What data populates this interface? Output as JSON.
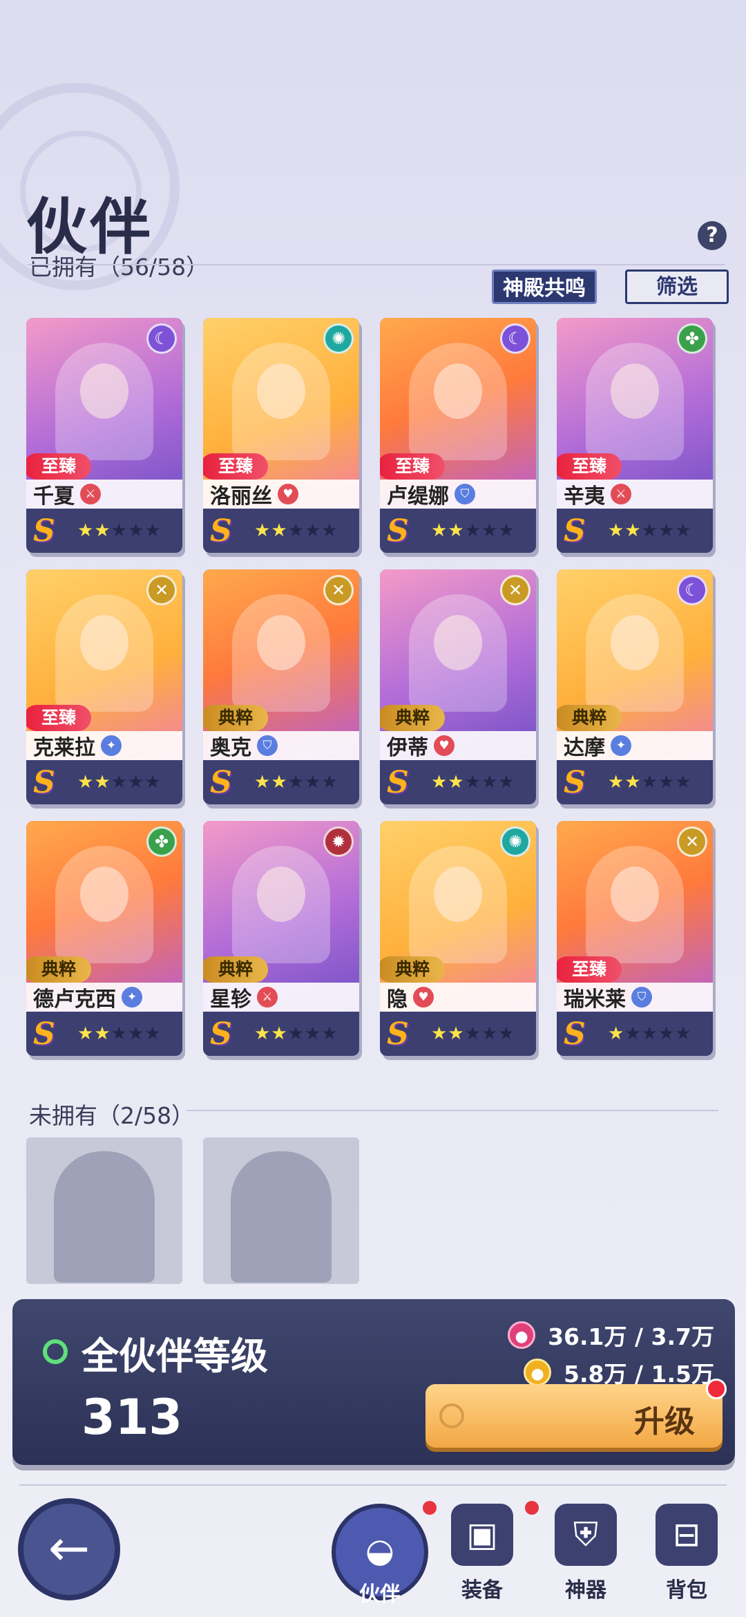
{
  "header": {
    "title": "伙伴",
    "owned_label": "已拥有（56/58）",
    "help_label": "?",
    "resonance_button": "神殿共鸣",
    "filter_button": "筛选"
  },
  "owned_heroes": [
    {
      "name": "千夏",
      "rarity": "至臻",
      "rarity_color": "#e8203c",
      "element_icon": "moon-icon",
      "class_icon": "sword-icon",
      "grade": "S",
      "stars": 2,
      "max_stars": 5
    },
    {
      "name": "洛丽丝",
      "rarity": "至臻",
      "rarity_color": "#e8203c",
      "element_icon": "wind-icon",
      "class_icon": "heart-icon",
      "grade": "S",
      "stars": 2,
      "max_stars": 5
    },
    {
      "name": "卢缇娜",
      "rarity": "至臻",
      "rarity_color": "#e8203c",
      "element_icon": "moon-icon",
      "class_icon": "shield-icon",
      "grade": "S",
      "stars": 2,
      "max_stars": 5
    },
    {
      "name": "辛夷",
      "rarity": "至臻",
      "rarity_color": "#e8203c",
      "element_icon": "leaf-icon",
      "class_icon": "sword-icon",
      "grade": "S",
      "stars": 2,
      "max_stars": 5
    },
    {
      "name": "克莱拉",
      "rarity": "至臻",
      "rarity_color": "#e8203c",
      "element_icon": "cross-icon",
      "class_icon": "blade-icon",
      "grade": "S",
      "stars": 2,
      "max_stars": 5
    },
    {
      "name": "奥克",
      "rarity": "典粹",
      "rarity_color": "#c98a20",
      "element_icon": "cross-icon",
      "class_icon": "shield-icon",
      "grade": "S",
      "stars": 2,
      "max_stars": 5
    },
    {
      "name": "伊蒂",
      "rarity": "典粹",
      "rarity_color": "#c98a20",
      "element_icon": "cross-icon",
      "class_icon": "heart-icon",
      "grade": "S",
      "stars": 2,
      "max_stars": 5
    },
    {
      "name": "达摩",
      "rarity": "典粹",
      "rarity_color": "#c98a20",
      "element_icon": "moon-icon",
      "class_icon": "blade-icon",
      "grade": "S",
      "stars": 2,
      "max_stars": 5
    },
    {
      "name": "德卢克西",
      "rarity": "典粹",
      "rarity_color": "#c98a20",
      "element_icon": "leaf-icon",
      "class_icon": "blade-icon",
      "grade": "S",
      "stars": 2,
      "max_stars": 5
    },
    {
      "name": "星轸",
      "rarity": "典粹",
      "rarity_color": "#c98a20",
      "element_icon": "blood-icon",
      "class_icon": "sword-icon",
      "grade": "S",
      "stars": 2,
      "max_stars": 5
    },
    {
      "name": "隐",
      "rarity": "典粹",
      "rarity_color": "#c98a20",
      "element_icon": "wind-icon",
      "class_icon": "heart-icon",
      "grade": "S",
      "stars": 2,
      "max_stars": 5
    },
    {
      "name": "瑞米莱",
      "rarity": "至臻",
      "rarity_color": "#e8203c",
      "element_icon": "cross-icon",
      "class_icon": "shield-icon",
      "grade": "S",
      "stars": 1,
      "max_stars": 5
    }
  ],
  "unowned": {
    "label": "未拥有（2/58）",
    "count_shown": 2
  },
  "level_panel": {
    "title": "全伙伴等级",
    "level": "313",
    "exp_resource": "36.1万 / 3.7万",
    "coin_resource": "5.8万 / 1.5万",
    "upgrade_label": "升级"
  },
  "nav": {
    "back_icon": "arrow-left-icon",
    "items": [
      {
        "label": "伙伴",
        "icon": "helmet-icon",
        "active": true,
        "badge": true
      },
      {
        "label": "装备",
        "icon": "armor-icon",
        "active": false,
        "badge": true
      },
      {
        "label": "神器",
        "icon": "artifact-icon",
        "active": false,
        "badge": false
      },
      {
        "label": "背包",
        "icon": "bag-icon",
        "active": false,
        "badge": false
      }
    ]
  }
}
